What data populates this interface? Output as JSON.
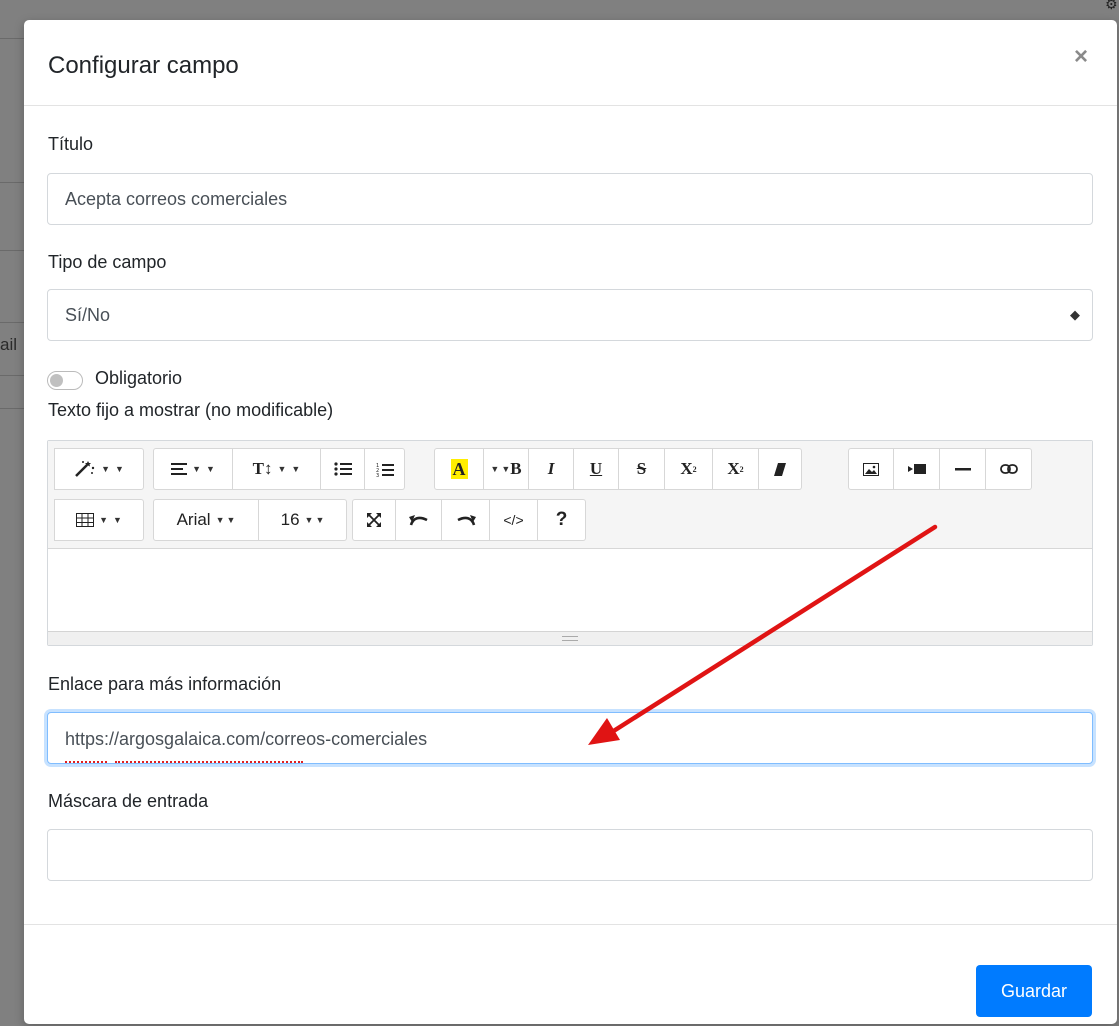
{
  "modal": {
    "title": "Configurar campo",
    "close_glyph": "×"
  },
  "form": {
    "title_label": "Título",
    "title_value": "Acepta correos comerciales",
    "type_label": "Tipo de campo",
    "type_value": "Sí/No",
    "required_label": "Obligatorio",
    "required_on": false,
    "fixed_text_label": "Texto fijo a mostrar (no modificable)",
    "link_label": "Enlace para más información",
    "link_value": "https://argosgalaica.com/correos-comerciales",
    "mask_label": "Máscara de entrada",
    "mask_value": ""
  },
  "editor_toolbar": {
    "font_name": "Arial",
    "font_size": "16",
    "highlight_color": "#ffee00",
    "icons": [
      "magic-wand-icon",
      "align-icon",
      "text-height-icon",
      "bullet-list-icon",
      "numbered-list-icon",
      "text-color-icon",
      "bold-icon",
      "italic-icon",
      "underline-icon",
      "strikethrough-icon",
      "superscript-icon",
      "subscript-icon",
      "eraser-icon",
      "image-icon",
      "video-icon",
      "horizontal-rule-icon",
      "link-icon",
      "table-icon",
      "fullscreen-icon",
      "undo-icon",
      "redo-icon",
      "code-view-icon",
      "help-icon"
    ]
  },
  "footer": {
    "save_label": "Guardar"
  },
  "annotation": {
    "arrow_color": "#e01414"
  },
  "background": {
    "partial_text": "ail"
  }
}
